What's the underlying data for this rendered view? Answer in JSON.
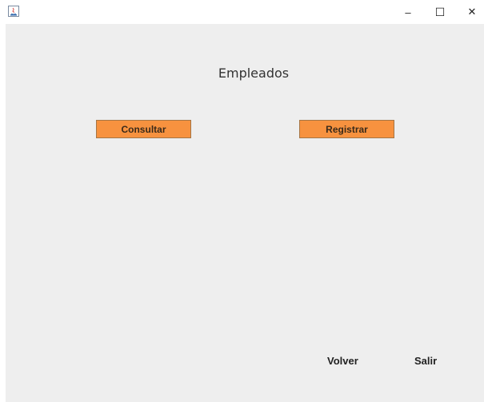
{
  "window": {
    "icon": "java-app-icon",
    "controls": {
      "minimize": "–",
      "maximize": "☐",
      "close": "✕"
    }
  },
  "main": {
    "title": "Empleados",
    "consultar_label": "Consultar",
    "registrar_label": "Registrar",
    "volver_label": "Volver",
    "salir_label": "Salir"
  },
  "colors": {
    "accent": "#f7923f",
    "panel_bg": "#eeeeee"
  }
}
